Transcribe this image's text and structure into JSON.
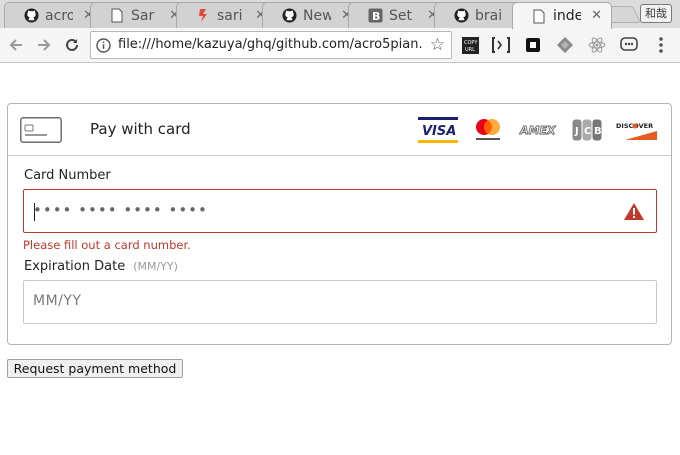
{
  "tabs": [
    {
      "title": "acro",
      "icon": "github-icon",
      "active": false
    },
    {
      "title": "Sar",
      "icon": "page-icon",
      "active": false
    },
    {
      "title": "sari",
      "icon": "red-s-icon",
      "active": false
    },
    {
      "title": "New",
      "icon": "github-icon",
      "active": false
    },
    {
      "title": "Set",
      "icon": "bootstrap-icon",
      "active": false
    },
    {
      "title": "brai",
      "icon": "github-icon",
      "active": false
    },
    {
      "title": "inde",
      "icon": "page-icon",
      "active": true
    }
  ],
  "profile_label": "和哉",
  "address_bar": {
    "url": "file:///home/kazuya/ghq/github.com/acro5pian..."
  },
  "payment": {
    "header_label": "Pay with card",
    "card_brands": [
      "VISA",
      "mastercard",
      "AMEX",
      "JCB",
      "DISCOVER"
    ],
    "card_number": {
      "label": "Card Number",
      "placeholder": "•••• •••• •••• ••••",
      "error": "Please fill out a card number."
    },
    "expiration": {
      "label": "Expiration Date",
      "hint": "(MM/YY)",
      "placeholder": "MM/YY"
    }
  },
  "request_button": "Request payment method",
  "colors": {
    "error": "#c0392b",
    "visa_blue": "#1a1f71",
    "mastercard_red": "#eb001b",
    "discover_orange": "#e55c20"
  }
}
